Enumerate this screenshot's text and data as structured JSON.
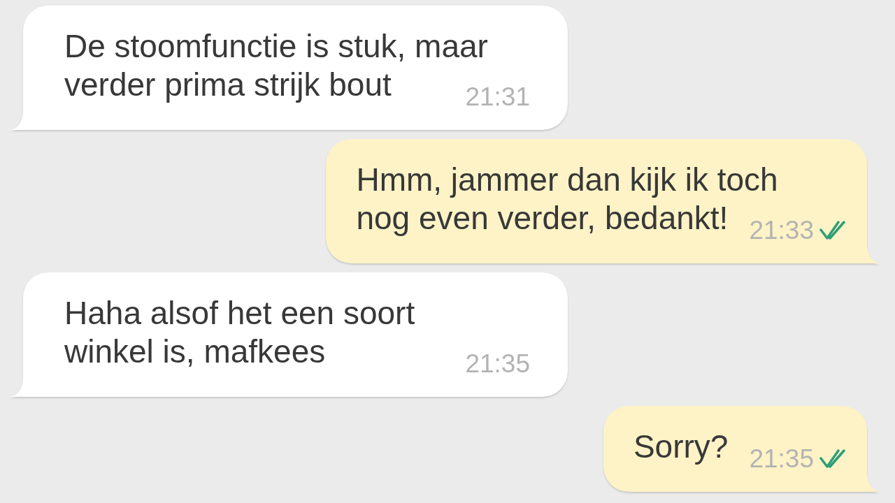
{
  "messages": [
    {
      "kind": "incoming",
      "text": "De stoomfunctie is stuk, maar\nverder prima strijk bout",
      "time": "21:31"
    },
    {
      "kind": "outgoing",
      "text": "Hmm, jammer dan kijk ik toch\nnog even verder, bedankt!",
      "time": "21:33",
      "read": true
    },
    {
      "kind": "incoming",
      "text": "Haha alsof het een soort\nwinkel is, mafkees",
      "time": "21:35"
    },
    {
      "kind": "outgoing",
      "text": "Sorry?",
      "time": "21:35",
      "read": true
    }
  ]
}
